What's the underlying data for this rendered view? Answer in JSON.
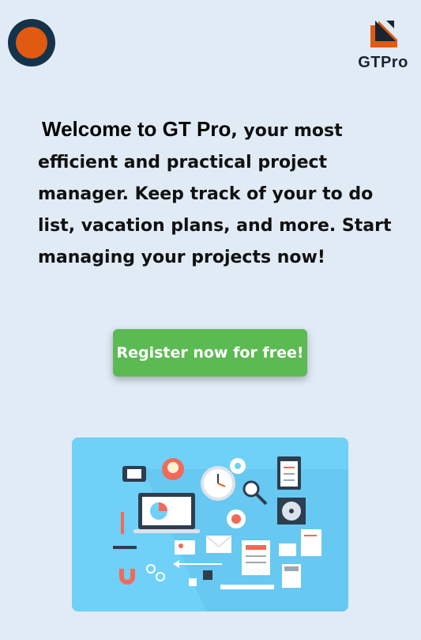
{
  "header": {
    "avatar_icon": "avatar-icon",
    "brand": {
      "logo_icon": "gtpro-logo-icon",
      "name": "GTPro"
    }
  },
  "intro": {
    "title": "Welcome to GT Pro",
    "body": ", your most efficient and practical project manager. Keep track of your to do list, vacation plans, and more. Start managing your projects now!"
  },
  "cta": {
    "label": "Register now for free!"
  },
  "hero": {
    "icon": "office-items-illustration"
  },
  "colors": {
    "background": "#e1ebf6",
    "cta": "#5cba53",
    "avatar_outer": "#14334a",
    "avatar_inner": "#e05a12",
    "hero_bg": "#6fd0f8"
  }
}
